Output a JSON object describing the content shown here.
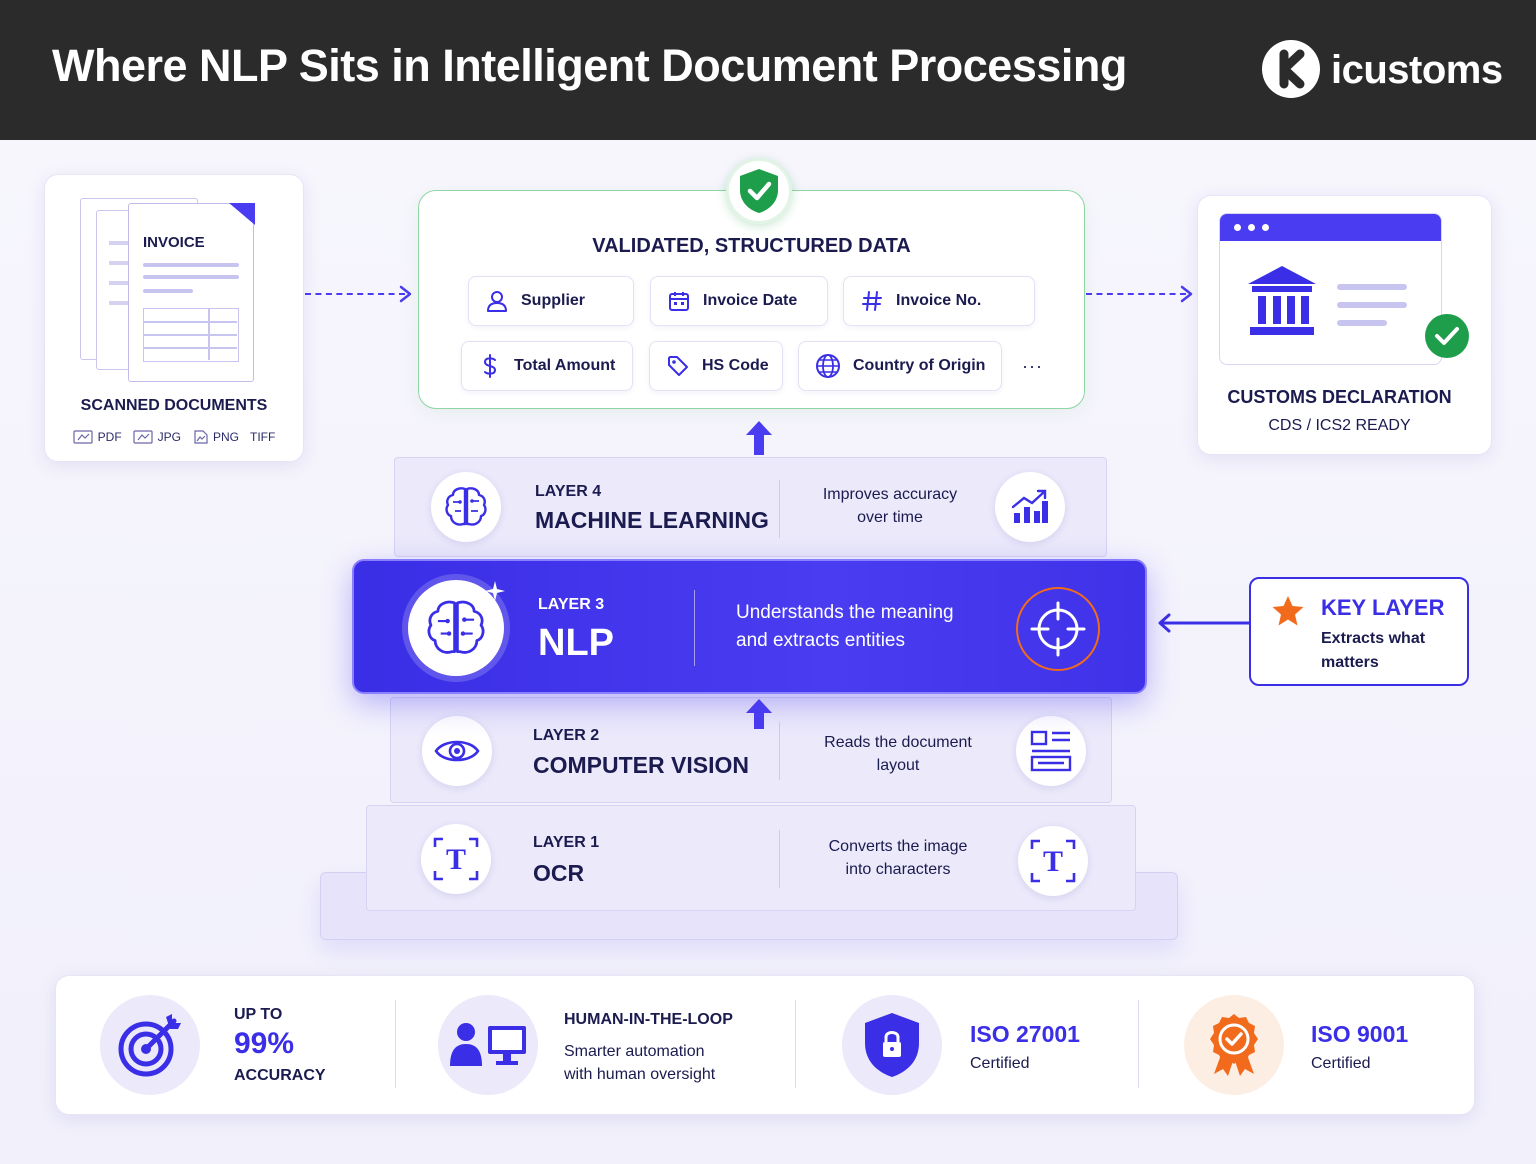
{
  "header": {
    "title": "Where NLP Sits in Intelligent Document Processing",
    "brand": "icustoms"
  },
  "source": {
    "doc_label": "INVOICE",
    "title": "SCANNED DOCUMENTS",
    "formats": [
      "PDF",
      "JPG",
      "PNG",
      "TIFF"
    ]
  },
  "validated": {
    "title": "VALIDATED, STRUCTURED DATA",
    "fields": [
      {
        "label": "Supplier",
        "icon": "user-icon"
      },
      {
        "label": "Invoice Date",
        "icon": "calendar-icon"
      },
      {
        "label": "Invoice No.",
        "icon": "hash-icon"
      },
      {
        "label": "Total Amount",
        "icon": "dollar-icon"
      },
      {
        "label": "HS Code",
        "icon": "tag-icon"
      },
      {
        "label": "Country of Origin",
        "icon": "globe-icon"
      }
    ],
    "more": "···"
  },
  "customs": {
    "title": "CUSTOMS DECLARATION",
    "subtitle": "CDS / ICS2 READY"
  },
  "layers": {
    "ml": {
      "kicker": "LAYER 4",
      "name": "MACHINE LEARNING",
      "desc_line1": "Improves accuracy",
      "desc_line2": "over time"
    },
    "nlp": {
      "kicker": "LAYER 3",
      "name": "NLP",
      "desc_line1": "Understands the meaning",
      "desc_line2": "and extracts entities"
    },
    "cv": {
      "kicker": "LAYER 2",
      "name": "COMPUTER VISION",
      "desc_line1": "Reads the document",
      "desc_line2": "layout"
    },
    "ocr": {
      "kicker": "LAYER 1",
      "name": "OCR",
      "desc_line1": "Converts the image",
      "desc_line2": "into characters"
    }
  },
  "key_layer": {
    "title": "KEY LAYER",
    "subtitle": "Extracts what matters"
  },
  "stats": {
    "accuracy": {
      "top": "UP TO",
      "value": "99%",
      "bottom": "ACCURACY"
    },
    "hitl": {
      "title": "HUMAN-IN-THE-LOOP",
      "line1": "Smarter automation",
      "line2": "with human oversight"
    },
    "iso27001": {
      "title": "ISO 27001",
      "sub": "Certified"
    },
    "iso9001": {
      "title": "ISO 9001",
      "sub": "Certified"
    }
  },
  "colors": {
    "accent": "#4a3cf0",
    "accent_dark": "#3a2ee6",
    "success": "#1e9e4a",
    "orange": "#f26a1b",
    "header_bg": "#2b2b2b"
  }
}
